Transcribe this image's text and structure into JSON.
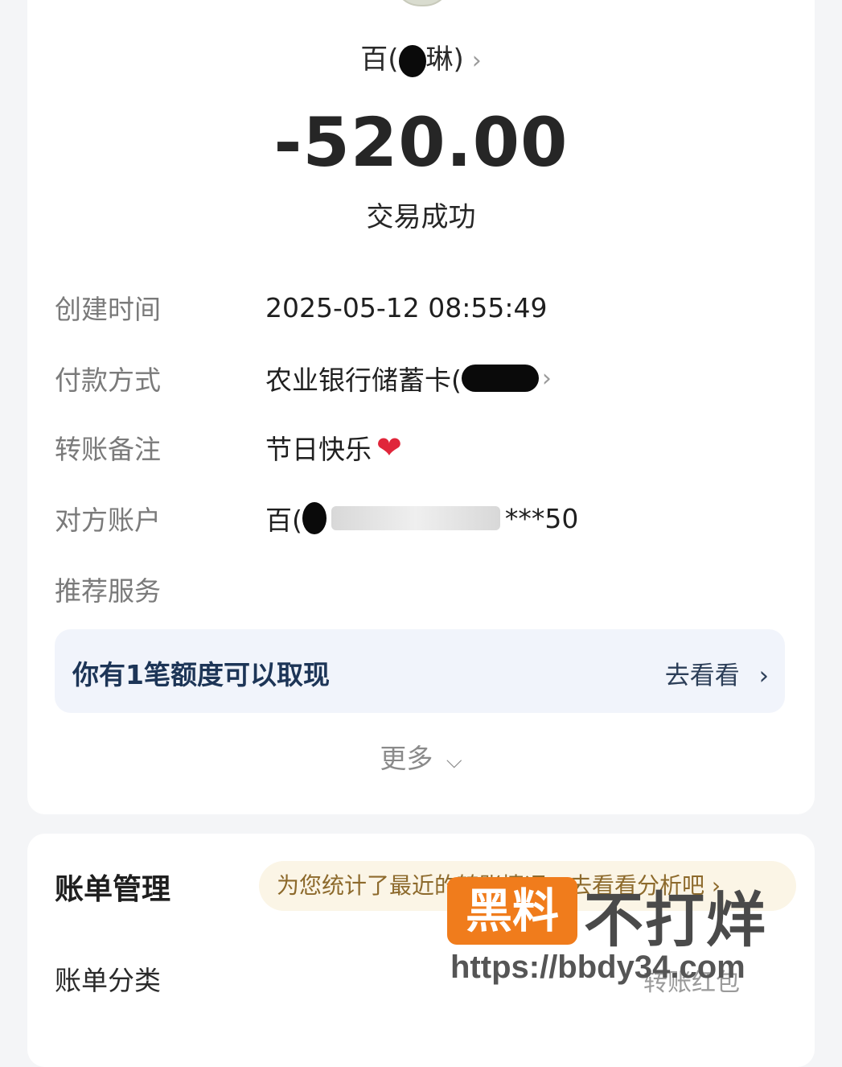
{
  "payee": {
    "name_prefix": "百(",
    "name_suffix": "琳)",
    "chevron": "›"
  },
  "amount": "-520.00",
  "status": "交易成功",
  "details": [
    {
      "label": "创建时间",
      "value": "2025-05-12 08:55:49"
    },
    {
      "label": "付款方式",
      "value": "农业银行储蓄卡("
    },
    {
      "label": "转账备注",
      "value": "节日快乐"
    },
    {
      "label": "对方账户",
      "value_prefix": "百(",
      "value_suffix": "***50"
    },
    {
      "label": "推荐服务",
      "value": ""
    }
  ],
  "icons": {
    "heart": "heart-emoji-icon",
    "chevron_right": "chevron-right-icon",
    "chevron_down": "chevron-down-icon"
  },
  "promo": {
    "text": "你有1笔额度可以取现",
    "action": "去看看"
  },
  "more": {
    "label": "更多"
  },
  "bill": {
    "title": "账单管理",
    "tip": "为您统计了最近的转账情况，去看看分析吧 ›",
    "category_label": "账单分类",
    "category_value": "转账红包"
  },
  "watermark": {
    "logo": "黑料",
    "brand": "不打烊",
    "url": "https://bbdy34.com"
  },
  "colors": {
    "heart": "#e0263a",
    "promo_bg": "#f1f4fb",
    "promo_text": "#1d3557",
    "tip_bg": "#fbf5e6",
    "tip_text": "#8d6a2c",
    "watermark_orange": "#f07c1c"
  }
}
